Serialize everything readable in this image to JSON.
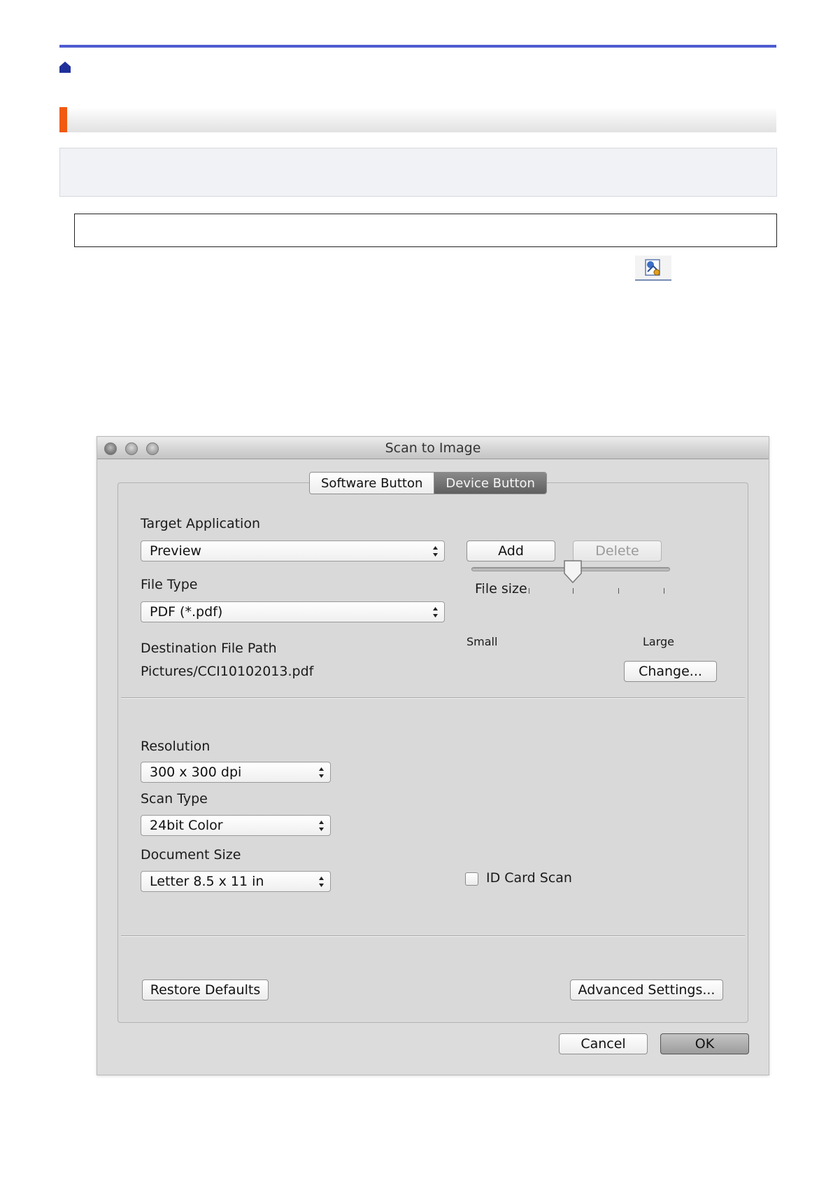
{
  "page": {
    "accent_rule_color": "#4e5bd0",
    "title_accent_color": "#f05a12"
  },
  "icons": {
    "home": "home-icon",
    "toolbar": "scan-settings-icon"
  },
  "dialog": {
    "title": "Scan to Image",
    "tabs": [
      {
        "label": "Software Button",
        "active": false
      },
      {
        "label": "Device Button",
        "active": true
      }
    ],
    "target_application": {
      "label": "Target Application",
      "value": "Preview"
    },
    "add_button": "Add",
    "delete_button": "Delete",
    "file_type": {
      "label": "File Type",
      "value": "PDF (*.pdf)"
    },
    "file_size": {
      "label": "File size",
      "min_label": "Small",
      "max_label": "Large",
      "level": 0.5
    },
    "destination": {
      "label": "Destination File Path",
      "value": "Pictures/CCI10102013.pdf"
    },
    "change_button": "Change...",
    "resolution": {
      "label": "Resolution",
      "value": "300 x 300 dpi"
    },
    "scan_type": {
      "label": "Scan Type",
      "value": "24bit Color"
    },
    "document_size": {
      "label": "Document Size",
      "value": "Letter 8.5 x 11 in"
    },
    "id_card_scan": {
      "label": "ID Card Scan",
      "checked": false
    },
    "restore_button": "Restore Defaults",
    "advanced_button": "Advanced Settings...",
    "cancel_button": "Cancel",
    "ok_button": "OK"
  }
}
